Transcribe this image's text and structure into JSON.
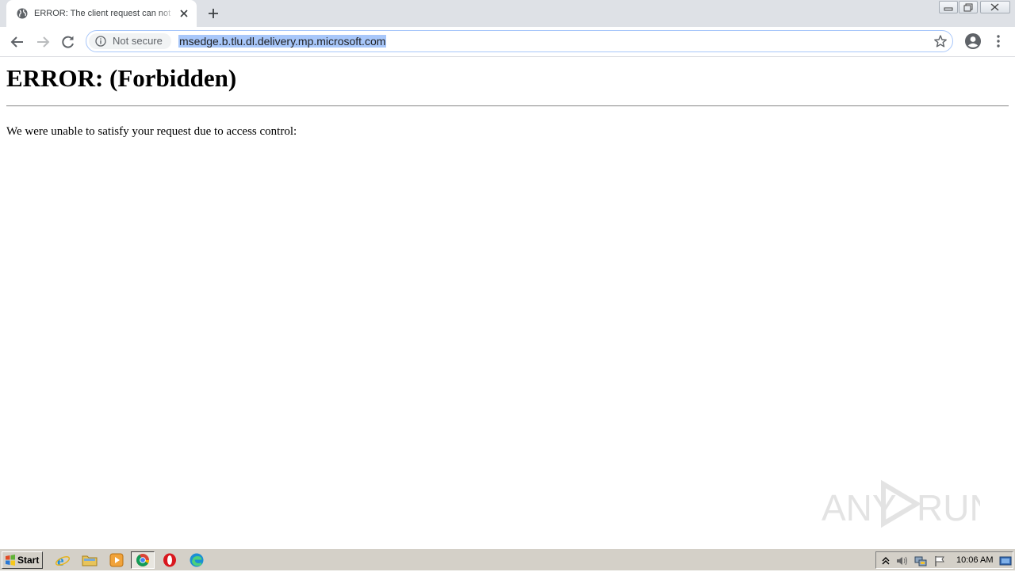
{
  "browser": {
    "tab": {
      "title": "ERROR: The client request can not be fulfilled",
      "favicon": "globe-icon"
    },
    "new_tab": "plus-icon",
    "nav": {
      "back": "back-arrow-icon",
      "forward": "forward-arrow-icon",
      "reload": "reload-icon"
    },
    "omnibox": {
      "security_label": "Not secure",
      "security_icon": "info-icon",
      "url": "msedge.b.tlu.dl.delivery.mp.microsoft.com",
      "url_selected": true,
      "bookmark_icon": "star-icon"
    },
    "profile_icon": "account-circle-icon",
    "menu_icon": "kebab-menu-icon"
  },
  "page": {
    "heading": "ERROR: (Forbidden)",
    "message": "We were unable to satisfy your request due to access control:"
  },
  "watermark": {
    "text_left": "ANY",
    "text_right": "RUN"
  },
  "taskbar": {
    "start_label": "Start",
    "apps": [
      "internet-explorer-icon",
      "folder-icon",
      "media-player-icon",
      "chrome-icon",
      "opera-icon",
      "edge-icon"
    ],
    "active_app": "chrome-icon",
    "tray_icons": [
      "show-hidden-icon",
      "volume-icon",
      "network-icon",
      "flag-icon"
    ],
    "clock": "10:06 AM",
    "desktop_icon": "show-desktop-icon"
  },
  "colors": {
    "tabbar_bg": "#dee1e6",
    "selection": "#a8c7fa",
    "taskbar_bg": "#d4d0c8"
  }
}
